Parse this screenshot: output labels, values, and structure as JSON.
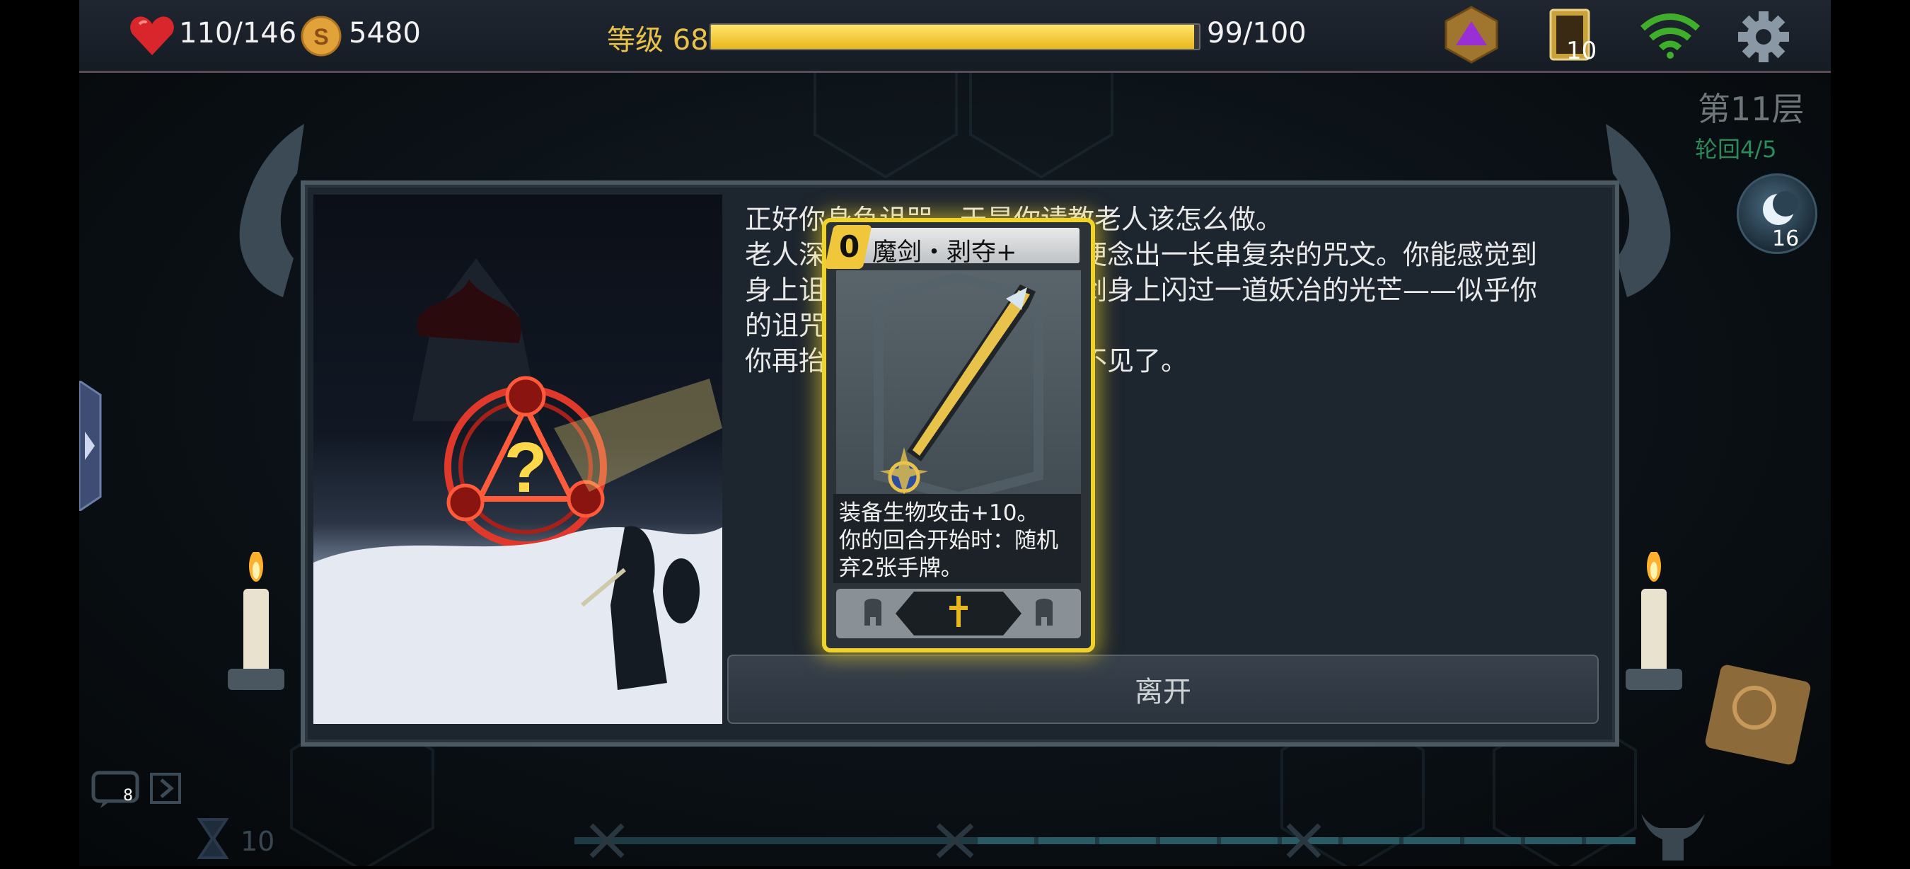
{
  "hud": {
    "hp": "110/146",
    "gold": "5480",
    "level_label": "等级 68",
    "xp_text": "99/100",
    "xp_progress": 0.99,
    "deck_count": "10"
  },
  "floor": {
    "title": "第11层",
    "round": "轮回4/5",
    "moon_count": "16"
  },
  "event": {
    "text_lines": [
      "正好你身负诅咒，于是你请教老人该怎么做。",
      "老人深",
      "身上诅",
      "的诅咒",
      "你再抬"
    ],
    "text_lines_right": [
      "",
      "便念出一长串复杂的咒文。你能感觉到",
      "剑身上闪过一道妖冶的光芒——似乎你",
      "。",
      "不见了。"
    ],
    "leave_label": "离开"
  },
  "card": {
    "cost": "0",
    "title": "魔剑・剥夺+",
    "desc_lines": [
      "装备生物攻击+10。",
      "你的回合开始时：随机",
      "弃2张手牌。"
    ]
  },
  "bottom": {
    "chat_count": "8",
    "turn_count": "10"
  },
  "colors": {
    "accent_gold": "#f0d22c",
    "xp_fill": "#f2c734",
    "heart": "#d8262c",
    "wifi": "#3fae2b"
  },
  "icons": [
    "heart-icon",
    "coin-icon",
    "d20-dice-icon",
    "card-deck-icon",
    "wifi-icon",
    "gear-icon",
    "moon-icon",
    "chat-icon",
    "hourglass-icon",
    "candle-icon",
    "sword-icon",
    "helmet-icon",
    "crossed-swords-icon",
    "horned-helmet-icon"
  ]
}
